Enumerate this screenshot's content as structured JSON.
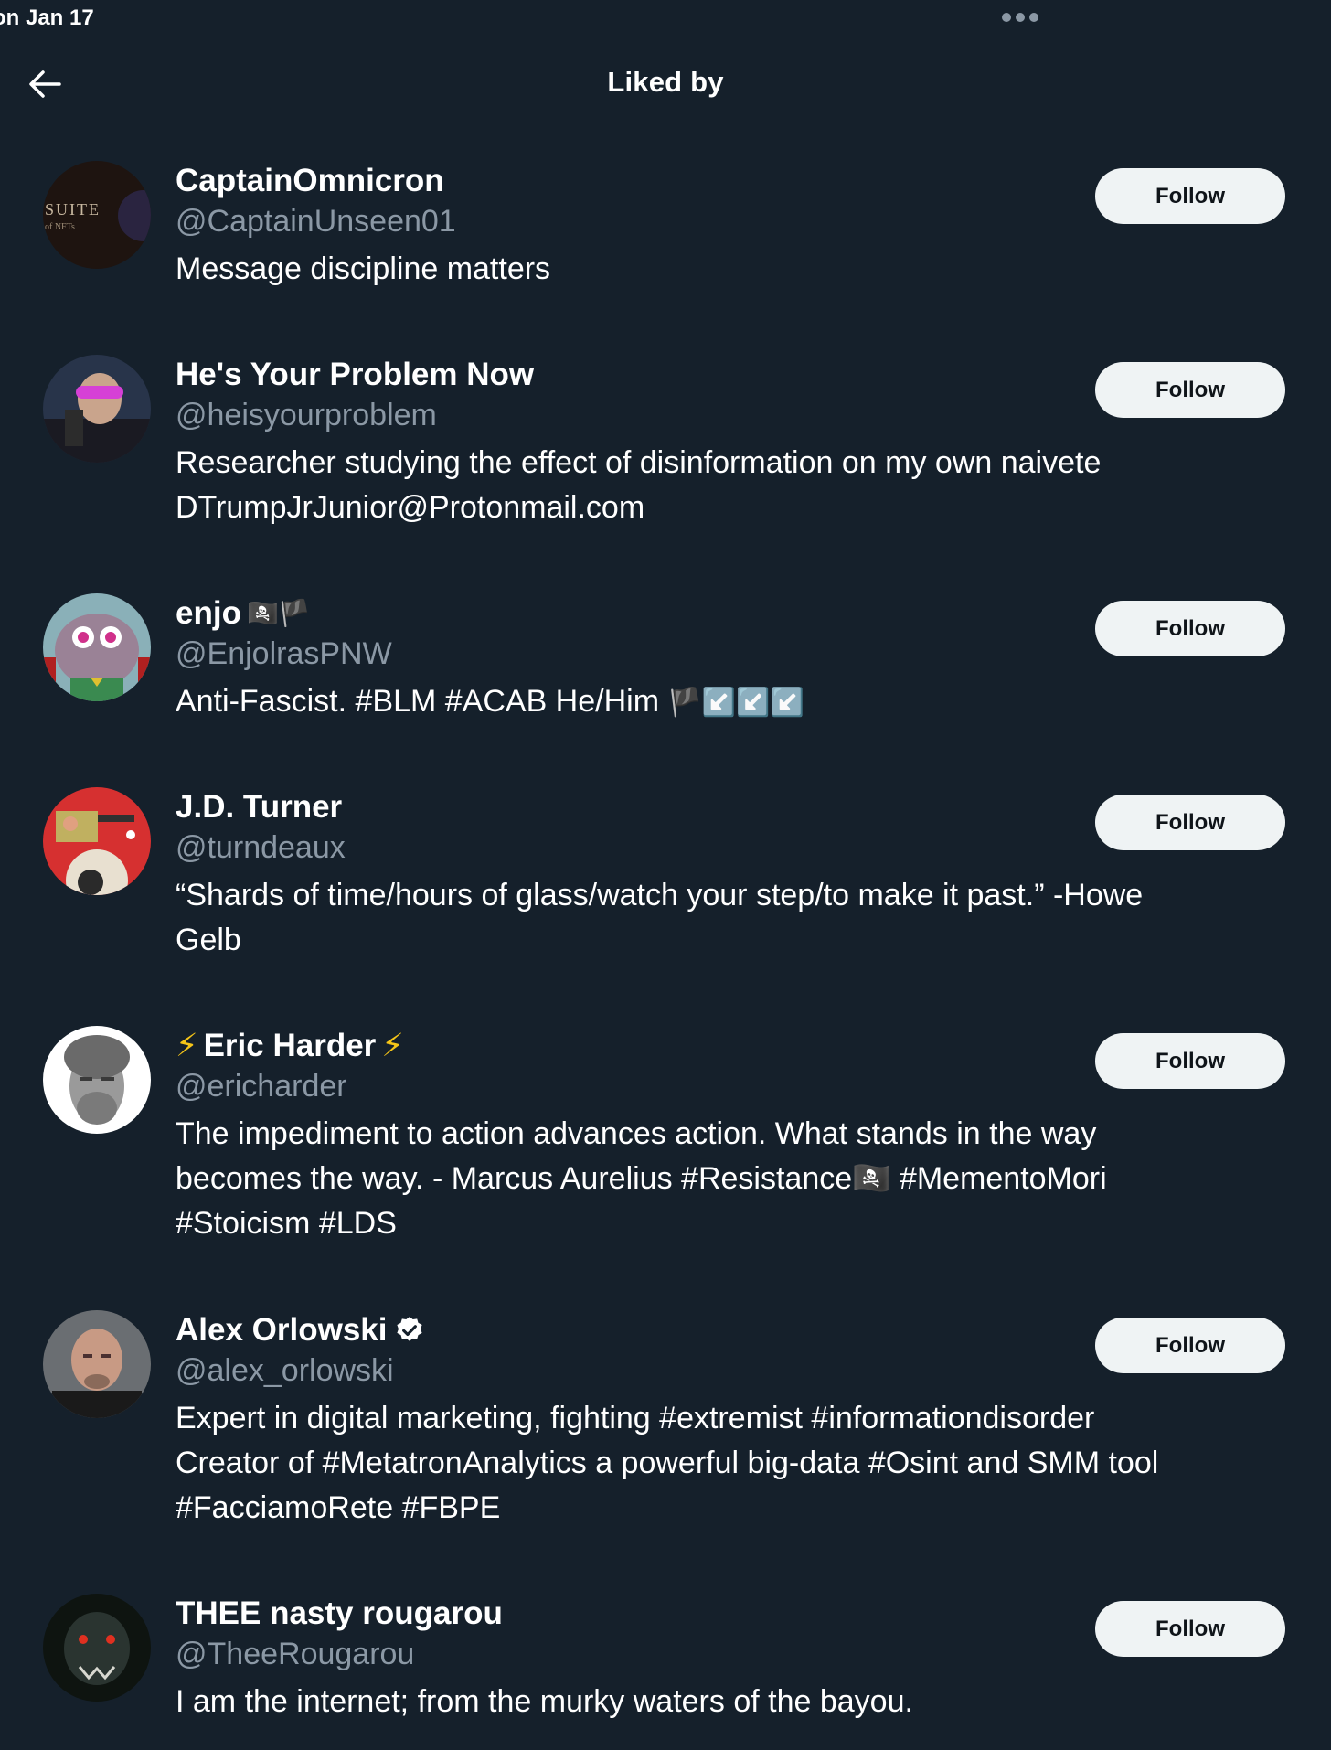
{
  "status_bar": {
    "time": "on Jan 17"
  },
  "header": {
    "title": "Liked by"
  },
  "icons": {
    "back": "arrow-left-icon",
    "more": "ellipsis-icon",
    "verified": "verified-badge-icon"
  },
  "colors": {
    "background": "#15202b",
    "secondary_text": "#8b98a5",
    "follow_bg": "#eff3f4"
  },
  "users": [
    {
      "name": "CaptainOmnicron",
      "handle": "@CaptainUnseen01",
      "bio": [
        "Message discipline matters"
      ],
      "follow_label": "Follow",
      "avatar_text": "SUITE",
      "avatar_subtext": "of NFTs"
    },
    {
      "name": "He's Your Problem Now",
      "handle": "@heisyourproblem",
      "bio": [
        "Researcher studying the effect of disinformation on my own naivete",
        "DTrumpJrJunior@Protonmail.com"
      ],
      "follow_label": "Follow"
    },
    {
      "name": "enjo",
      "name_suffix": "🏴‍☠️🏴",
      "handle": "@EnjolrasPNW",
      "bio": [
        "Anti-Fascist. #BLM #ACAB He/Him"
      ],
      "bio_suffix": "🏴↙️↙️↙️",
      "follow_label": "Follow"
    },
    {
      "name": "J.D. Turner",
      "handle": "@turndeaux",
      "bio": [
        "“Shards of time/hours of glass/watch your step/to make it past.” -Howe",
        "Gelb"
      ],
      "follow_label": "Follow"
    },
    {
      "name": "Eric Harder",
      "name_prefix": "⚡",
      "name_suffix": "⚡",
      "handle": "@ericharder",
      "bio": [
        "The impediment to action advances action. What stands in the way",
        "becomes the way. - Marcus Aurelius #Resistance🏴‍☠️ #MementoMori",
        "#Stoicism #LDS"
      ],
      "follow_label": "Follow"
    },
    {
      "name": "Alex Orlowski",
      "handle": "@alex_orlowski",
      "bio": [
        "Expert in digital marketing, fighting #extremist #informationdisorder",
        "Creator of #MetatronAnalytics a powerful big-data #Osint and SMM tool",
        "#FacciamoRete #FBPE"
      ],
      "follow_label": "Follow",
      "verified": true
    },
    {
      "name": "THEE nasty rougarou",
      "handle": "@TheeRougarou",
      "bio": [
        "I am the internet; from the murky waters of the bayou."
      ],
      "follow_label": "Follow"
    }
  ]
}
